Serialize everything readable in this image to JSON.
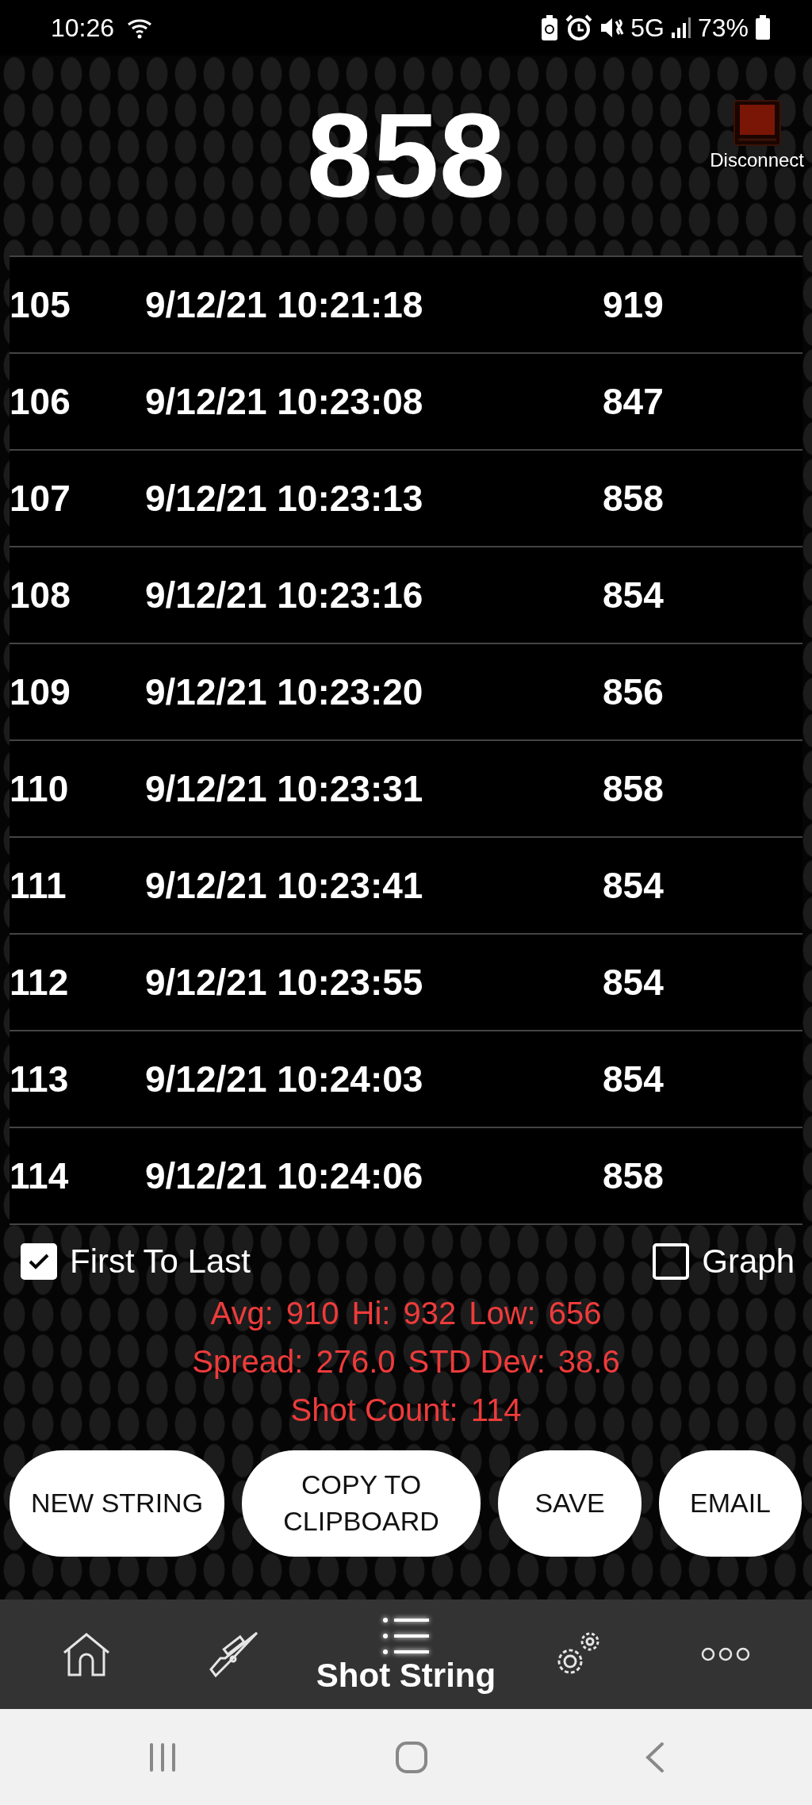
{
  "status_bar": {
    "time": "10:26",
    "network": "5G",
    "battery": "73%"
  },
  "header": {
    "speed": "858",
    "disconnect": "Disconnect"
  },
  "shots": [
    {
      "number": "105",
      "time": "9/12/21 10:21:18",
      "velocity": "919"
    },
    {
      "number": "106",
      "time": "9/12/21 10:23:08",
      "velocity": "847"
    },
    {
      "number": "107",
      "time": "9/12/21 10:23:13",
      "velocity": "858"
    },
    {
      "number": "108",
      "time": "9/12/21 10:23:16",
      "velocity": "854"
    },
    {
      "number": "109",
      "time": "9/12/21 10:23:20",
      "velocity": "856"
    },
    {
      "number": "110",
      "time": "9/12/21 10:23:31",
      "velocity": "858"
    },
    {
      "number": "111",
      "time": "9/12/21 10:23:41",
      "velocity": "854"
    },
    {
      "number": "112",
      "time": "9/12/21 10:23:55",
      "velocity": "854"
    },
    {
      "number": "113",
      "time": "9/12/21 10:24:03",
      "velocity": "854"
    },
    {
      "number": "114",
      "time": "9/12/21 10:24:06",
      "velocity": "858"
    }
  ],
  "options": [
    {
      "label": "First To Last",
      "checked": true
    },
    {
      "label": "Graph",
      "checked": false
    }
  ],
  "stats": [
    [
      {
        "label": "Avg:",
        "value": "910"
      },
      {
        "label": "Hi:",
        "value": "932"
      },
      {
        "label": "Low:",
        "value": "656"
      }
    ],
    [
      {
        "label": "Spread:",
        "value": "276.0"
      },
      {
        "label": "STD Dev:",
        "value": "38.6"
      }
    ],
    [
      {
        "label": "Shot Count:",
        "value": "114"
      }
    ]
  ],
  "buttons": [
    "NEW STRING",
    "COPY TO CLIPBOARD",
    "SAVE",
    "EMAIL"
  ],
  "nav": [
    {
      "kind": "home",
      "selected": false
    },
    {
      "kind": "rifle",
      "selected": false
    },
    {
      "kind": "list",
      "label": "Shot String",
      "selected": true
    },
    {
      "kind": "gears",
      "selected": false
    },
    {
      "kind": "more",
      "selected": false
    }
  ]
}
